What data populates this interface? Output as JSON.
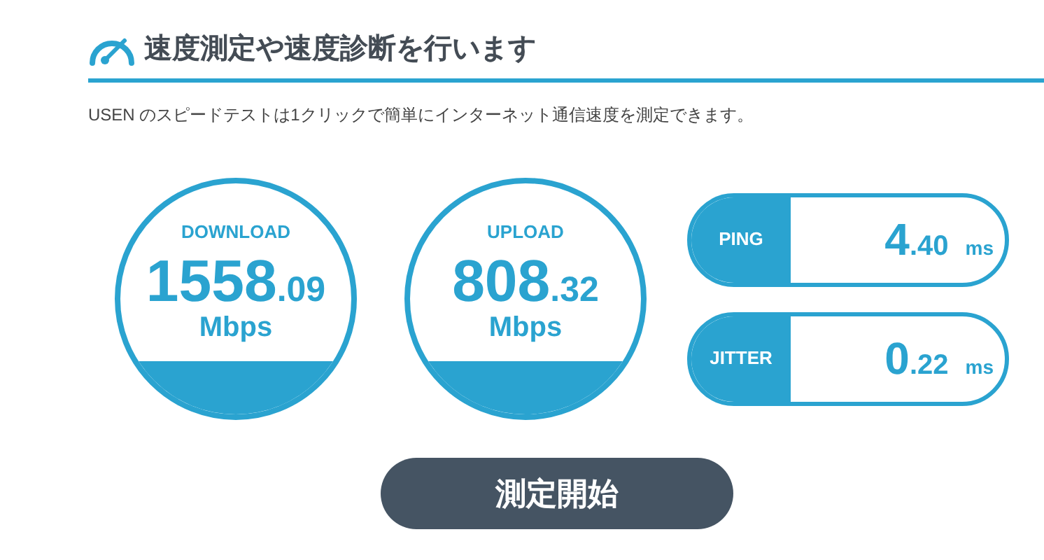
{
  "header": {
    "title": "速度測定や速度診断を行います"
  },
  "description": "USEN のスピードテストは1クリックで簡単にインターネット通信速度を測定できます。",
  "gauges": [
    {
      "label": "DOWNLOAD",
      "integer": "1558",
      "decimal": ".09",
      "unit": "Mbps"
    },
    {
      "label": "UPLOAD",
      "integer": "808",
      "decimal": ".32",
      "unit": "Mbps"
    }
  ],
  "metrics": [
    {
      "label": "PING",
      "integer": "4",
      "decimal": ".40",
      "unit": "ms"
    },
    {
      "label": "JITTER",
      "integer": "0",
      "decimal": ".22",
      "unit": "ms"
    }
  ],
  "start_button": "測定開始"
}
